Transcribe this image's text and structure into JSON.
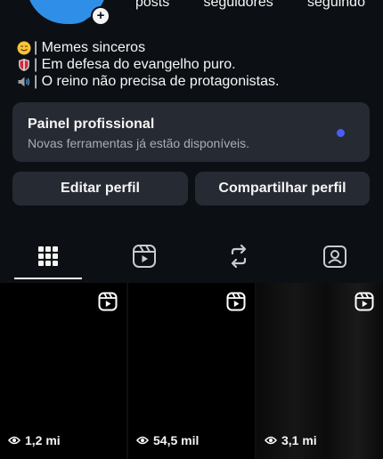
{
  "profile": {
    "stats": {
      "posts_label": "posts",
      "followers_label": "seguidores",
      "following_label": "seguindo"
    },
    "bio": [
      {
        "icon": "smile-emoji",
        "text": "| Memes sinceros"
      },
      {
        "icon": "shield-emoji",
        "text": "| Em defesa do evangelho puro."
      },
      {
        "icon": "speaker-emoji",
        "text": "| O reino não precisa de protagonistas."
      }
    ]
  },
  "panel": {
    "title": "Painel profissional",
    "subtitle": "Novas ferramentas já estão disponíveis."
  },
  "buttons": {
    "edit": "Editar perfil",
    "share": "Compartilhar perfil"
  },
  "tabs": [
    "grid-icon",
    "reels-icon",
    "reposts-icon",
    "tagged-icon"
  ],
  "grid": [
    {
      "views": "1,2 mi"
    },
    {
      "views": "54,5 mil"
    },
    {
      "views": "3,1 mi"
    }
  ],
  "colors": {
    "background": "#0c1014",
    "card": "#262b33",
    "accent_dot": "#4a5df9",
    "avatar": "#2f8fe8"
  }
}
